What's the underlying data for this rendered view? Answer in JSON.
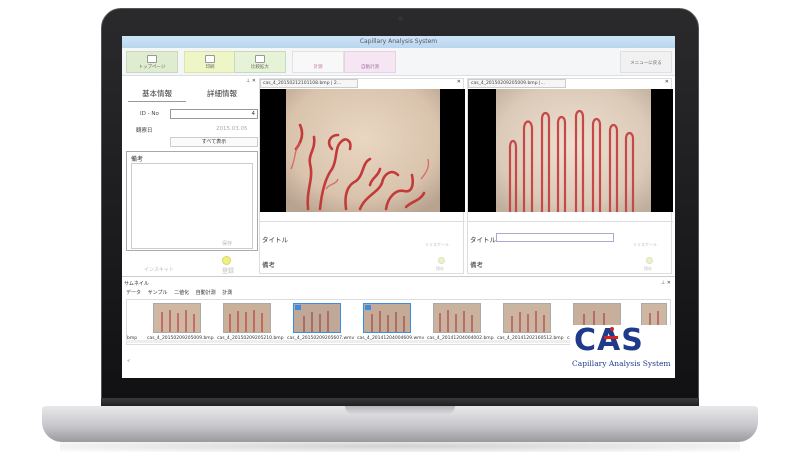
{
  "window": {
    "title": "Capillary Analysis System"
  },
  "toolbar": {
    "top_label": "トップページ",
    "print_label": "印刷",
    "compare_label": "比較拡大",
    "measure_label": "計測",
    "auto_measure_label": "自動計測",
    "menu_label": "メニューに戻る"
  },
  "left_panel": {
    "tab_basic": "基本情報",
    "tab_detail": "詳細情報",
    "id_label": "ID - No",
    "id_value": "4",
    "date_label": "観察日",
    "date_value": "2015.03.05",
    "show_all_label": "すべて表示",
    "memo_label": "備考",
    "memo_save": "保存",
    "insert_label": "インスキャト",
    "register_label": "登録"
  },
  "viewer_left": {
    "tab_label": "cas_4_20150212101108.bmp |  2...",
    "title_label": "タイトル",
    "mark_label": "ミリスケール",
    "memo_label": "備考",
    "save_label": "保存"
  },
  "viewer_right": {
    "tab_label": "cas_4_20150209205009.bmp |...",
    "title_label": "タイトル",
    "mark_label": "ミリスケール",
    "memo_label": "備考",
    "save_label": "保存"
  },
  "thumbnails": {
    "title": "サムネイル",
    "tabs": [
      "データ",
      "サンプル",
      "二値化",
      "自動計測",
      "計測"
    ],
    "first_caption": "bmp",
    "items": [
      {
        "caption": "cas_4_20150209205009.bmp"
      },
      {
        "caption": "cas_4_20150209205210.bmp"
      },
      {
        "caption": "cas_4_20150209205607.wmv"
      },
      {
        "caption": "cas_4_20141204004609.wmv"
      },
      {
        "caption": "cas_4_20141204004002.bmp"
      },
      {
        "caption": "cas_4_20141202160512.bmp"
      },
      {
        "caption": "cas_4_20141202..."
      },
      {
        "caption": "cas_4_20141..."
      }
    ]
  },
  "logo": {
    "text": "CAS",
    "subtitle": "Capillary Analysis System"
  }
}
